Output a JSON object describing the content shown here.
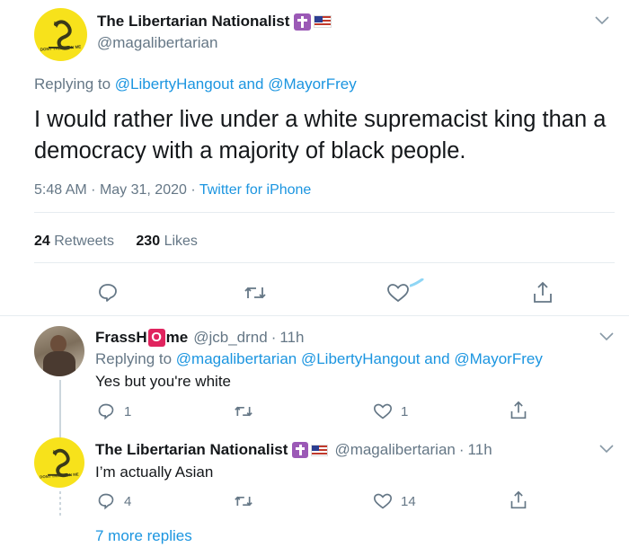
{
  "main_tweet": {
    "name": "The Libertarian Nationalist",
    "handle": "@magalibertarian",
    "avatar_text": "DONT TREAD ON ME",
    "replying_prefix": "Replying to",
    "replying_user1": "@LibertyHangout",
    "replying_and": "and",
    "replying_user2": "@MayorFrey",
    "text": "I would rather live under a white supremacist king than a democracy with a majority of black people.",
    "time": "5:48 AM",
    "sep1": "·",
    "date": "May 31, 2020",
    "sep2": "·",
    "source": "Twitter for iPhone",
    "retweets_count": "24",
    "retweets_label": "Retweets",
    "likes_count": "230",
    "likes_label": "Likes"
  },
  "reply1": {
    "name_part1": "FrassH",
    "name_o": "O",
    "name_part2": "me",
    "handle": "@jcb_drnd",
    "sep": "·",
    "time": "11h",
    "replying_prefix": "Replying to",
    "replying_users": "@magalibertarian @LibertyHangout",
    "replying_and": "and",
    "replying_user3": "@MayorFrey",
    "text": "Yes but you're white",
    "reply_count": "1",
    "like_count": "1"
  },
  "reply2": {
    "name": "The Libertarian Nationalist",
    "handle": "@magalibertarian",
    "sep": "·",
    "time": "11h",
    "avatar_text": "DONT TREAD ON ME",
    "text": "I’m actually Asian",
    "reply_count": "4",
    "like_count": "14"
  },
  "more_replies": "7 more replies",
  "colors": {
    "accent": "#1b95e0",
    "muted": "#657786",
    "divider": "#e6ecf0",
    "avatar_yellow": "#f7e21b",
    "cross_purple": "#9b59b6",
    "o_badge": "#e0245e"
  }
}
